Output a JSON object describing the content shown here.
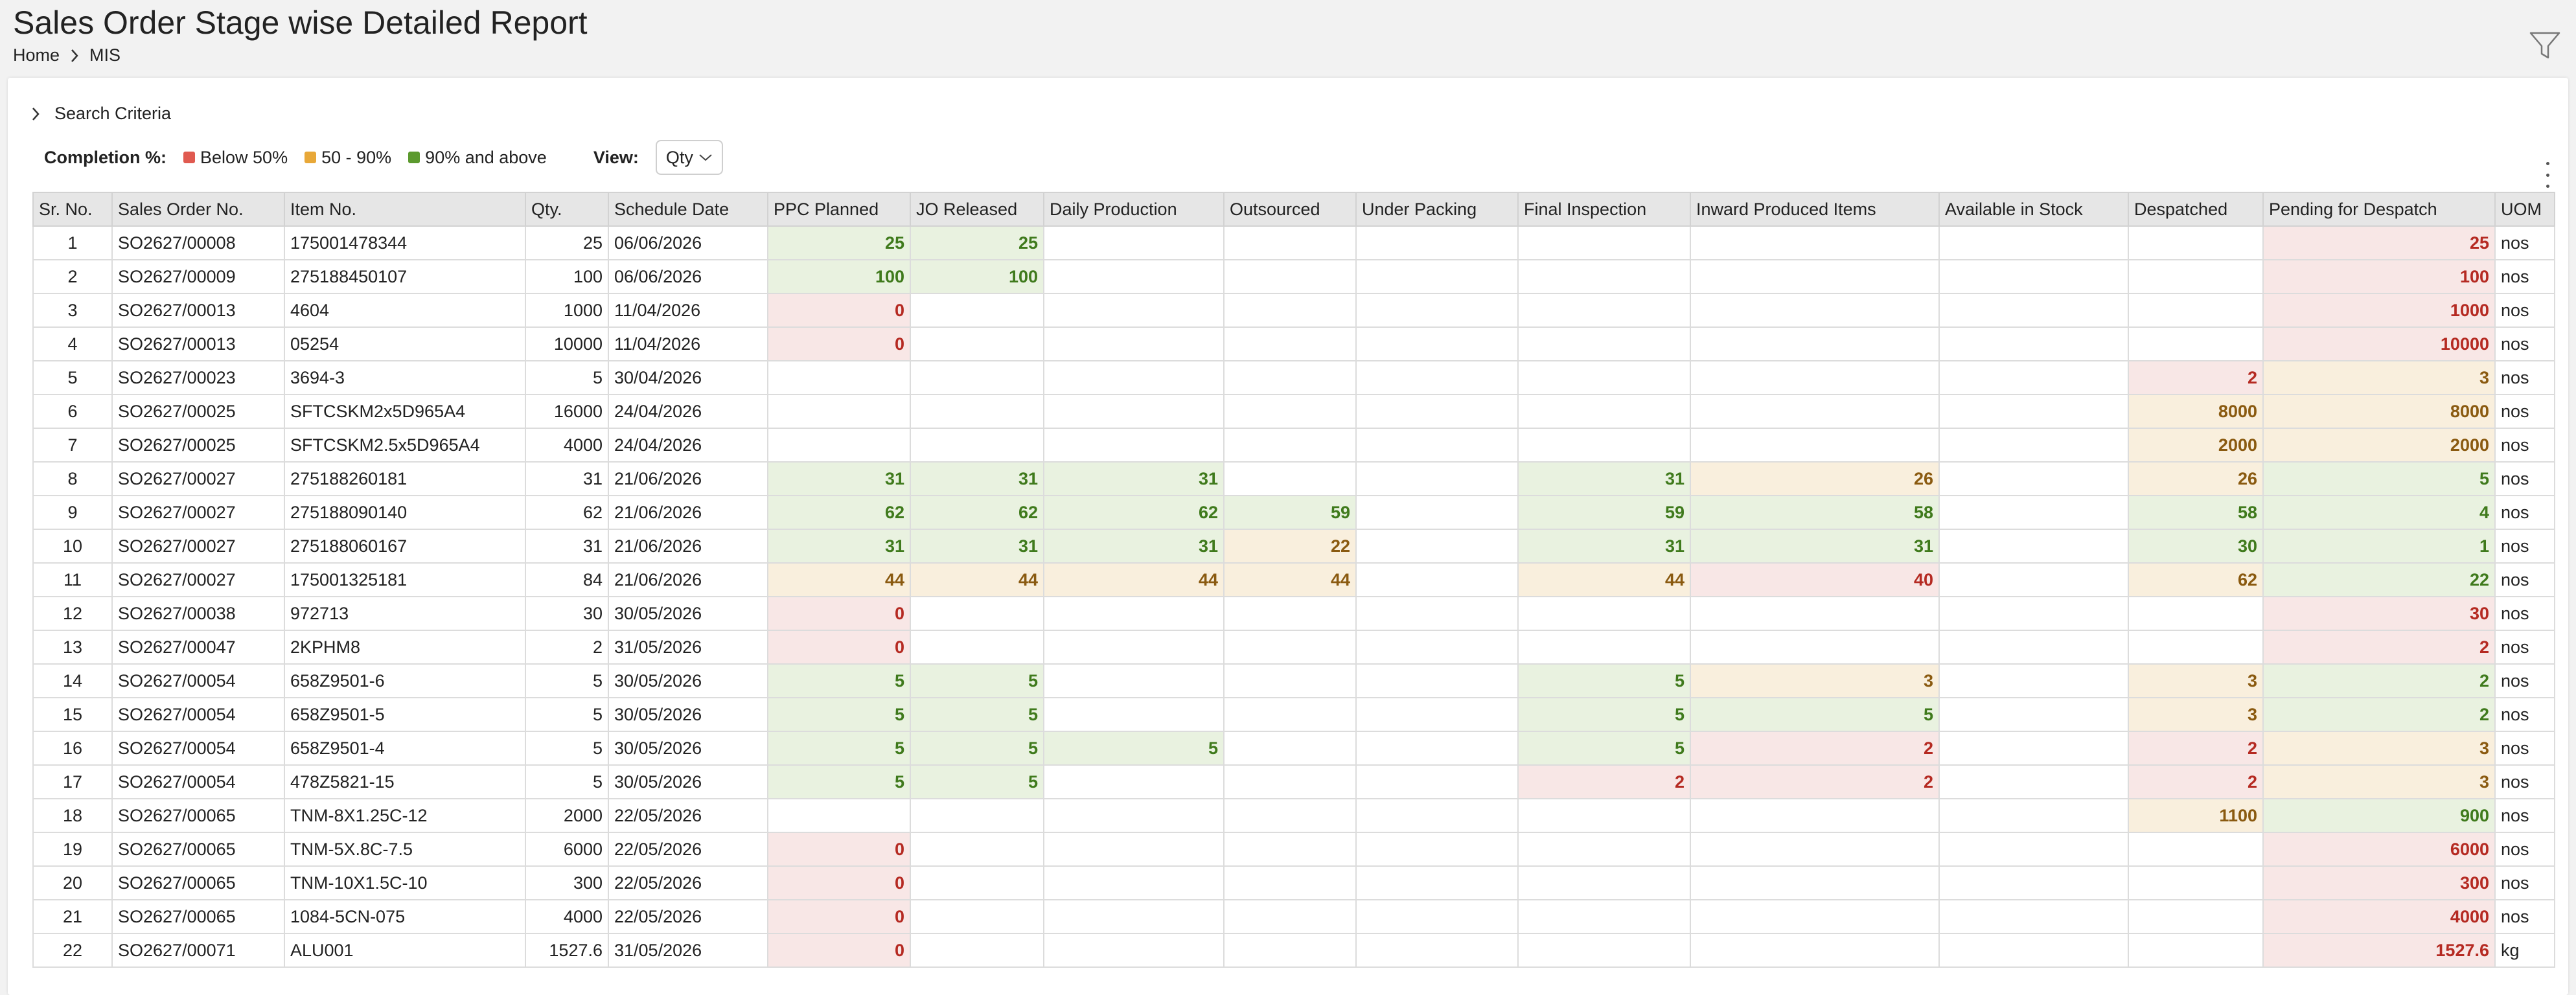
{
  "header": {
    "title": "Sales Order Stage wise Detailed Report",
    "breadcrumb": [
      "Home",
      "MIS"
    ]
  },
  "icons": {
    "filter": "filter-icon",
    "chevron_right": "chevron-right-icon",
    "chevron_down": "chevron-down-icon",
    "more": "more-vertical-icon"
  },
  "search_criteria": {
    "label": "Search Criteria"
  },
  "legend": {
    "title": "Completion %:",
    "items": [
      {
        "label": "Below 50%",
        "color": "#e05a50"
      },
      {
        "label": "50 - 90%",
        "color": "#e8a838"
      },
      {
        "label": "90% and above",
        "color": "#5c9a2e"
      }
    ]
  },
  "view": {
    "label": "View:",
    "selected": "Qty"
  },
  "colors": {
    "red_bg": "#f8e7e6",
    "red_text": "#b52a22",
    "amber_bg": "#f9efdd",
    "amber_text": "#8a5a10",
    "green_bg": "#e9f2e0",
    "green_text": "#3f7a1c"
  },
  "table": {
    "columns": [
      "Sr. No.",
      "Sales Order No.",
      "Item No.",
      "Qty.",
      "Schedule Date",
      "PPC Planned",
      "JO Released",
      "Daily Production",
      "Outsourced",
      "Under Packing",
      "Final Inspection",
      "Inward Produced Items",
      "Available in Stock",
      "Despatched",
      "Pending for Despatch",
      "UOM"
    ],
    "rows": [
      [
        "1",
        "SO2627/00008",
        "175001478344",
        "25",
        "06/06/2026",
        "25",
        "25",
        "",
        "",
        "",
        "",
        "",
        "",
        "",
        "25",
        "nos"
      ],
      [
        "2",
        "SO2627/00009",
        "275188450107",
        "100",
        "06/06/2026",
        "100",
        "100",
        "",
        "",
        "",
        "",
        "",
        "",
        "",
        "100",
        "nos"
      ],
      [
        "3",
        "SO2627/00013",
        "4604",
        "1000",
        "11/04/2026",
        "0",
        "",
        "",
        "",
        "",
        "",
        "",
        "",
        "",
        "1000",
        "nos"
      ],
      [
        "4",
        "SO2627/00013",
        "05254",
        "10000",
        "11/04/2026",
        "0",
        "",
        "",
        "",
        "",
        "",
        "",
        "",
        "",
        "10000",
        "nos"
      ],
      [
        "5",
        "SO2627/00023",
        "3694-3",
        "5",
        "30/04/2026",
        "",
        "",
        "",
        "",
        "",
        "",
        "",
        "",
        "2",
        "3",
        "nos"
      ],
      [
        "6",
        "SO2627/00025",
        "SFTCSKM2x5D965A4",
        "16000",
        "24/04/2026",
        "",
        "",
        "",
        "",
        "",
        "",
        "",
        "",
        "8000",
        "8000",
        "nos"
      ],
      [
        "7",
        "SO2627/00025",
        "SFTCSKM2.5x5D965A4",
        "4000",
        "24/04/2026",
        "",
        "",
        "",
        "",
        "",
        "",
        "",
        "",
        "2000",
        "2000",
        "nos"
      ],
      [
        "8",
        "SO2627/00027",
        "275188260181",
        "31",
        "21/06/2026",
        "31",
        "31",
        "31",
        "",
        "",
        "31",
        "26",
        "",
        "26",
        "5",
        "nos"
      ],
      [
        "9",
        "SO2627/00027",
        "275188090140",
        "62",
        "21/06/2026",
        "62",
        "62",
        "62",
        "59",
        "",
        "59",
        "58",
        "",
        "58",
        "4",
        "nos"
      ],
      [
        "10",
        "SO2627/00027",
        "275188060167",
        "31",
        "21/06/2026",
        "31",
        "31",
        "31",
        "22",
        "",
        "31",
        "31",
        "",
        "30",
        "1",
        "nos"
      ],
      [
        "11",
        "SO2627/00027",
        "175001325181",
        "84",
        "21/06/2026",
        "44",
        "44",
        "44",
        "44",
        "",
        "44",
        "40",
        "",
        "62",
        "22",
        "nos"
      ],
      [
        "12",
        "SO2627/00038",
        "972713",
        "30",
        "30/05/2026",
        "0",
        "",
        "",
        "",
        "",
        "",
        "",
        "",
        "",
        "30",
        "nos"
      ],
      [
        "13",
        "SO2627/00047",
        "2KPHM8",
        "2",
        "31/05/2026",
        "0",
        "",
        "",
        "",
        "",
        "",
        "",
        "",
        "",
        "2",
        "nos"
      ],
      [
        "14",
        "SO2627/00054",
        "658Z9501-6",
        "5",
        "30/05/2026",
        "5",
        "5",
        "",
        "",
        "",
        "5",
        "3",
        "",
        "3",
        "2",
        "nos"
      ],
      [
        "15",
        "SO2627/00054",
        "658Z9501-5",
        "5",
        "30/05/2026",
        "5",
        "5",
        "",
        "",
        "",
        "5",
        "5",
        "",
        "3",
        "2",
        "nos"
      ],
      [
        "16",
        "SO2627/00054",
        "658Z9501-4",
        "5",
        "30/05/2026",
        "5",
        "5",
        "5",
        "",
        "",
        "5",
        "2",
        "",
        "2",
        "3",
        "nos"
      ],
      [
        "17",
        "SO2627/00054",
        "478Z5821-15",
        "5",
        "30/05/2026",
        "5",
        "5",
        "",
        "",
        "",
        "2",
        "2",
        "",
        "2",
        "3",
        "nos"
      ],
      [
        "18",
        "SO2627/00065",
        "TNM-8X1.25C-12",
        "2000",
        "22/05/2026",
        "",
        "",
        "",
        "",
        "",
        "",
        "",
        "",
        "1100",
        "900",
        "nos"
      ],
      [
        "19",
        "SO2627/00065",
        "TNM-5X.8C-7.5",
        "6000",
        "22/05/2026",
        "0",
        "",
        "",
        "",
        "",
        "",
        "",
        "",
        "",
        "6000",
        "nos"
      ],
      [
        "20",
        "SO2627/00065",
        "TNM-10X1.5C-10",
        "300",
        "22/05/2026",
        "0",
        "",
        "",
        "",
        "",
        "",
        "",
        "",
        "",
        "300",
        "nos"
      ],
      [
        "21",
        "SO2627/00065",
        "1084-5CN-075",
        "4000",
        "22/05/2026",
        "0",
        "",
        "",
        "",
        "",
        "",
        "",
        "",
        "",
        "4000",
        "nos"
      ],
      [
        "22",
        "SO2627/00071",
        "ALU001",
        "1527.6",
        "31/05/2026",
        "0",
        "",
        "",
        "",
        "",
        "",
        "",
        "",
        "",
        "1527.6",
        "kg"
      ]
    ],
    "cell_status": [
      [
        null,
        null,
        null,
        null,
        null,
        "green",
        "green",
        null,
        null,
        null,
        null,
        null,
        null,
        null,
        "red",
        null
      ],
      [
        null,
        null,
        null,
        null,
        null,
        "green",
        "green",
        null,
        null,
        null,
        null,
        null,
        null,
        null,
        "red",
        null
      ],
      [
        null,
        null,
        null,
        null,
        null,
        "red",
        null,
        null,
        null,
        null,
        null,
        null,
        null,
        null,
        "red",
        null
      ],
      [
        null,
        null,
        null,
        null,
        null,
        "red",
        null,
        null,
        null,
        null,
        null,
        null,
        null,
        null,
        "red",
        null
      ],
      [
        null,
        null,
        null,
        null,
        null,
        null,
        null,
        null,
        null,
        null,
        null,
        null,
        null,
        "red",
        "amber",
        null
      ],
      [
        null,
        null,
        null,
        null,
        null,
        null,
        null,
        null,
        null,
        null,
        null,
        null,
        null,
        "amber",
        "amber",
        null
      ],
      [
        null,
        null,
        null,
        null,
        null,
        null,
        null,
        null,
        null,
        null,
        null,
        null,
        null,
        "amber",
        "amber",
        null
      ],
      [
        null,
        null,
        null,
        null,
        null,
        "green",
        "green",
        "green",
        null,
        null,
        "green",
        "amber",
        null,
        "amber",
        "green",
        null
      ],
      [
        null,
        null,
        null,
        null,
        null,
        "green",
        "green",
        "green",
        "green",
        null,
        "green",
        "green",
        null,
        "green",
        "green",
        null
      ],
      [
        null,
        null,
        null,
        null,
        null,
        "green",
        "green",
        "green",
        "amber",
        null,
        "green",
        "green",
        null,
        "green",
        "green",
        null
      ],
      [
        null,
        null,
        null,
        null,
        null,
        "amber",
        "amber",
        "amber",
        "amber",
        null,
        "amber",
        "red",
        null,
        "amber",
        "green",
        null
      ],
      [
        null,
        null,
        null,
        null,
        null,
        "red",
        null,
        null,
        null,
        null,
        null,
        null,
        null,
        null,
        "red",
        null
      ],
      [
        null,
        null,
        null,
        null,
        null,
        "red",
        null,
        null,
        null,
        null,
        null,
        null,
        null,
        null,
        "red",
        null
      ],
      [
        null,
        null,
        null,
        null,
        null,
        "green",
        "green",
        null,
        null,
        null,
        "green",
        "amber",
        null,
        "amber",
        "green",
        null
      ],
      [
        null,
        null,
        null,
        null,
        null,
        "green",
        "green",
        null,
        null,
        null,
        "green",
        "green",
        null,
        "amber",
        "green",
        null
      ],
      [
        null,
        null,
        null,
        null,
        null,
        "green",
        "green",
        "green",
        null,
        null,
        "green",
        "red",
        null,
        "red",
        "amber",
        null
      ],
      [
        null,
        null,
        null,
        null,
        null,
        "green",
        "green",
        null,
        null,
        null,
        "red",
        "red",
        null,
        "red",
        "amber",
        null
      ],
      [
        null,
        null,
        null,
        null,
        null,
        null,
        null,
        null,
        null,
        null,
        null,
        null,
        null,
        "amber",
        "green",
        null
      ],
      [
        null,
        null,
        null,
        null,
        null,
        "red",
        null,
        null,
        null,
        null,
        null,
        null,
        null,
        null,
        "red",
        null
      ],
      [
        null,
        null,
        null,
        null,
        null,
        "red",
        null,
        null,
        null,
        null,
        null,
        null,
        null,
        null,
        "red",
        null
      ],
      [
        null,
        null,
        null,
        null,
        null,
        "red",
        null,
        null,
        null,
        null,
        null,
        null,
        null,
        null,
        "red",
        null
      ],
      [
        null,
        null,
        null,
        null,
        null,
        "red",
        null,
        null,
        null,
        null,
        null,
        null,
        null,
        null,
        "red",
        null
      ]
    ]
  }
}
